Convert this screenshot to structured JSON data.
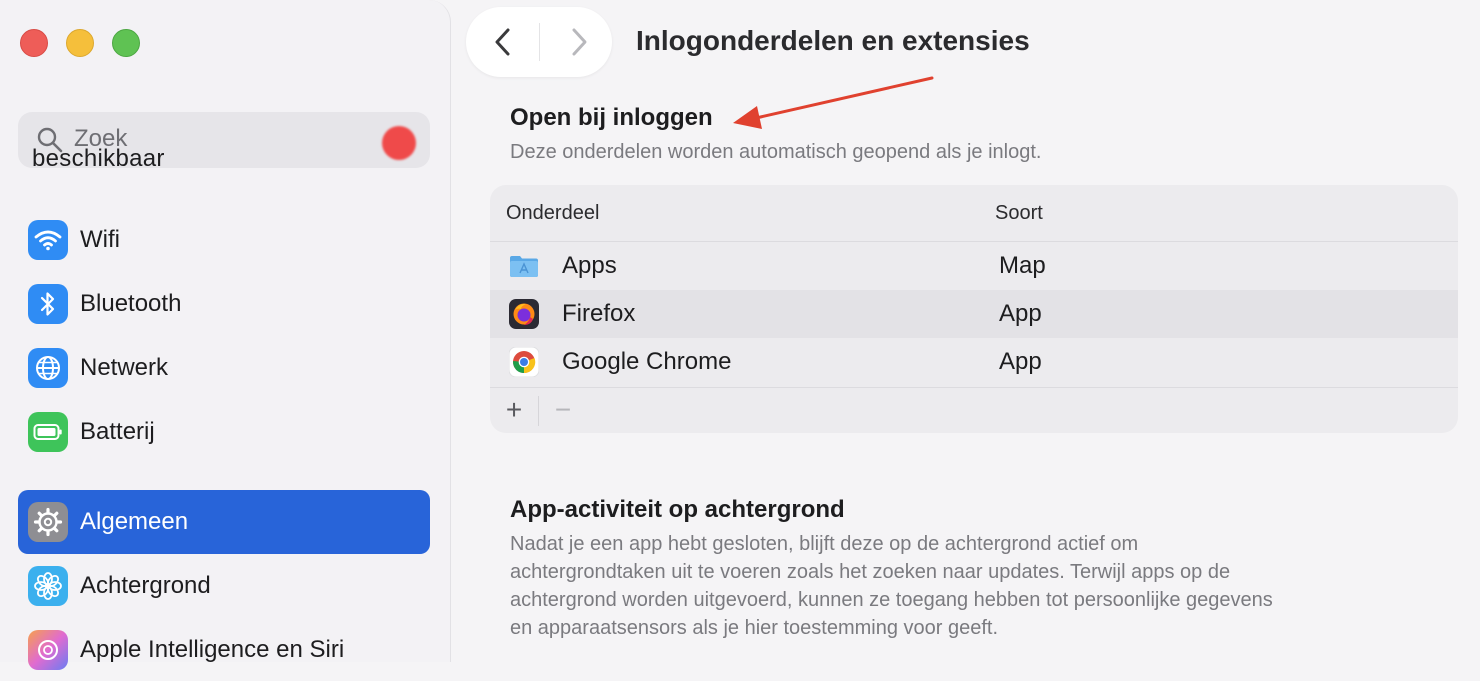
{
  "window": {
    "title": "Inlogonderdelen en extensies"
  },
  "sidebar": {
    "search_placeholder": "Zoek",
    "ghost_text": "beschikbaar",
    "items": [
      {
        "label": "Wifi",
        "icon": "wifi-icon",
        "color": "#2f8cf4"
      },
      {
        "label": "Bluetooth",
        "icon": "bluetooth-icon",
        "color": "#2f8cf4"
      },
      {
        "label": "Netwerk",
        "icon": "globe-icon",
        "color": "#2f8cf4"
      },
      {
        "label": "Batterij",
        "icon": "battery-icon",
        "color": "#3ec45a"
      },
      {
        "label": "Algemeen",
        "icon": "gear-icon",
        "color": "#8e8e93",
        "selected": true
      },
      {
        "label": "Achtergrond",
        "icon": "flower-icon",
        "color": "#3bb0ee"
      },
      {
        "label": "Apple Intelligence en Siri",
        "icon": "siri-icon",
        "color": "#e06bd0"
      }
    ]
  },
  "main": {
    "open_at_login": {
      "title": "Open bij inloggen",
      "subtitle": "Deze onderdelen worden automatisch geopend als je inlogt.",
      "columns": [
        "Onderdeel",
        "Soort"
      ],
      "rows": [
        {
          "name": "Apps",
          "kind": "Map",
          "icon": "folder-icon"
        },
        {
          "name": "Firefox",
          "kind": "App",
          "icon": "firefox-icon"
        },
        {
          "name": "Google Chrome",
          "kind": "App",
          "icon": "chrome-icon"
        }
      ],
      "add_label": "+",
      "remove_label": "−"
    },
    "background": {
      "title": "App-activiteit op achtergrond",
      "description": [
        "Nadat je een app hebt gesloten, blijft deze op de achtergrond actief om",
        "achtergrondtaken uit te voeren zoals het zoeken naar updates. Terwijl apps op de",
        "achtergrond worden uitgevoerd, kunnen ze toegang hebben tot persoonlijke gegevens",
        "en apparaatsensors als je hier toestemming voor geeft."
      ]
    }
  },
  "colors": {
    "accent": "#2864d9",
    "annotation_arrow": "#e0412f"
  }
}
